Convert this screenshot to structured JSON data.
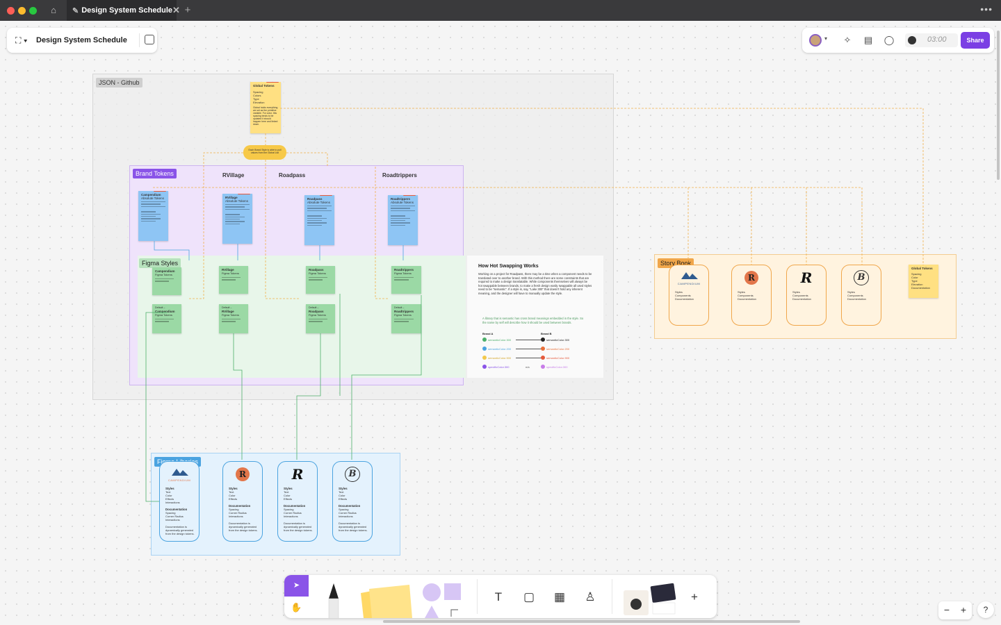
{
  "window": {
    "tab_title": "Design System Schedule",
    "more_label": "•••",
    "newtab_label": "+",
    "close_label": "✕"
  },
  "filebar": {
    "title": "Design System Schedule"
  },
  "rightbar": {
    "timer": "03:00",
    "share_label": "Share"
  },
  "sections": {
    "json_github": "JSON - Github",
    "brand_tokens": "Brand Tokens",
    "figma_styles": "Figma Styles",
    "story_book": "Story Book",
    "figma_libraries": "Figma Libaries"
  },
  "columns": [
    "RVillage",
    "Roadpass",
    "Roadtrippers"
  ],
  "global_tokens": {
    "title": "Global Tokens",
    "items": [
      "Spacing",
      "Colors",
      "Type",
      "Elevation"
    ],
    "note": "Global holds everything we set as the primitive variable. For color, this spacing tends to be updated it should happen here and linked down."
  },
  "connector_note": "Each Brand Style is able to pull values from the Global List",
  "brand_token_cards": [
    {
      "name": "Campendium",
      "sub": "Absolute Tokens"
    },
    {
      "name": "RVillage",
      "sub": "Absolute Tokens"
    },
    {
      "name": "Roadpass",
      "sub": "Absolute Tokens"
    },
    {
      "name": "Roadtrippers",
      "sub": "Absolute Tokens"
    }
  ],
  "style_cards": [
    {
      "name": "Campendium",
      "sub": "Figma Tokens"
    },
    {
      "name": "RVillage",
      "sub": "Figma Tokens"
    },
    {
      "name": "Roadpass",
      "sub": "Figma Tokens"
    },
    {
      "name": "Roadtrippers",
      "sub": "Figma Tokens"
    }
  ],
  "default_cards": [
    {
      "name": "Campendium",
      "sub": "Figma Tokens"
    },
    {
      "name": "RVillage",
      "sub": "Figma Tokens"
    },
    {
      "name": "Roadpass",
      "sub": "Figma Tokens"
    },
    {
      "name": "Roadtrippers",
      "sub": "Figma Tokens"
    }
  ],
  "hot_swap": {
    "title": "How Hot Swapping Works",
    "body": "Working on a project for Roadpass, there may be a time when a component needs to be translated over to another brand. With this method there are some constraints that are required to make a design translatable. While components themselves will always be hot swappable between brands, to make a fresh design easily swappable all used styles need to be \"semantic\". If a style is, say, \"Lake 300\" that doesn't hold any inherent meaning, and the designer will have to manually update the style.",
    "note": "A library that is semantic has cross brand meanings embedded in the style. So the name by self will describe how it should be used between brands.",
    "brand_a": "Brand A",
    "brand_b": "Brand B",
    "rows": [
      {
        "a": "semanticColor.300",
        "b": "semanticColor.300",
        "color_a": "#4caf6a",
        "color_b": "#222222"
      },
      {
        "a": "semanticColor.200",
        "b": "semanticColor.200",
        "color_a": "#4aa3e0",
        "color_b": "#e8703a"
      },
      {
        "a": "semanticColor.900",
        "b": "semanticColor.900",
        "color_a": "#f2c94c",
        "color_b": "#e55a3c"
      },
      {
        "a": "specificColor.300",
        "b": "specificColor.300",
        "mid": "n/a",
        "color_a": "#8a54e8",
        "color_b": "#c77de8"
      }
    ]
  },
  "story_cards": [
    {
      "logo": "CAMPENDIUM",
      "items": [
        "Styles",
        "Components",
        "Documentation"
      ]
    },
    {
      "logo": "R",
      "items": [
        "Styles",
        "Components",
        "Documentation"
      ]
    },
    {
      "logo": "R",
      "items": [
        "Styles",
        "Components",
        "Documentation"
      ]
    },
    {
      "logo": "B",
      "items": [
        "Styles",
        "Components",
        "Documentation"
      ]
    }
  ],
  "story_global": {
    "title": "Global Tokens",
    "items": [
      "Spacing",
      "Color",
      "Type",
      "Elevation",
      "Documentation"
    ]
  },
  "library_cards": [
    {
      "logo": "CAMPENDIUM",
      "styles": [
        "Text",
        "Color",
        "Effects",
        "Interactions"
      ],
      "docs": [
        "Spacing",
        "Corner Radius",
        "Interactions"
      ],
      "footer": "Documentation is dynamically generated from the design tokens."
    },
    {
      "logo": "R",
      "styles": [
        "Text",
        "Color",
        "Effects"
      ],
      "docs": [
        "Spacing",
        "Corner Radius",
        "Interactions"
      ],
      "footer": "Documentation is dynamically generated from the design tokens."
    },
    {
      "logo": "R",
      "styles": [
        "Text",
        "Color",
        "Effects"
      ],
      "docs": [
        "Spacing",
        "Corner Radius",
        "Interactions"
      ],
      "footer": "Documentation is dynamically generated from the design tokens."
    },
    {
      "logo": "B",
      "styles": [
        "Text",
        "Color",
        "Effects"
      ],
      "docs": [
        "Spacing",
        "Corner Radius",
        "Interactions"
      ],
      "footer": "Documentation is dynamically generated from the design tokens."
    }
  ],
  "zoom": {
    "minus": "−",
    "plus": "+"
  },
  "help": "?",
  "colors": {
    "accent": "#7b3fe4",
    "brand_tokens_label": "#8a54e8",
    "figma_libraries_label": "#4aa3e0",
    "story_book_label": "#f0a64a"
  }
}
